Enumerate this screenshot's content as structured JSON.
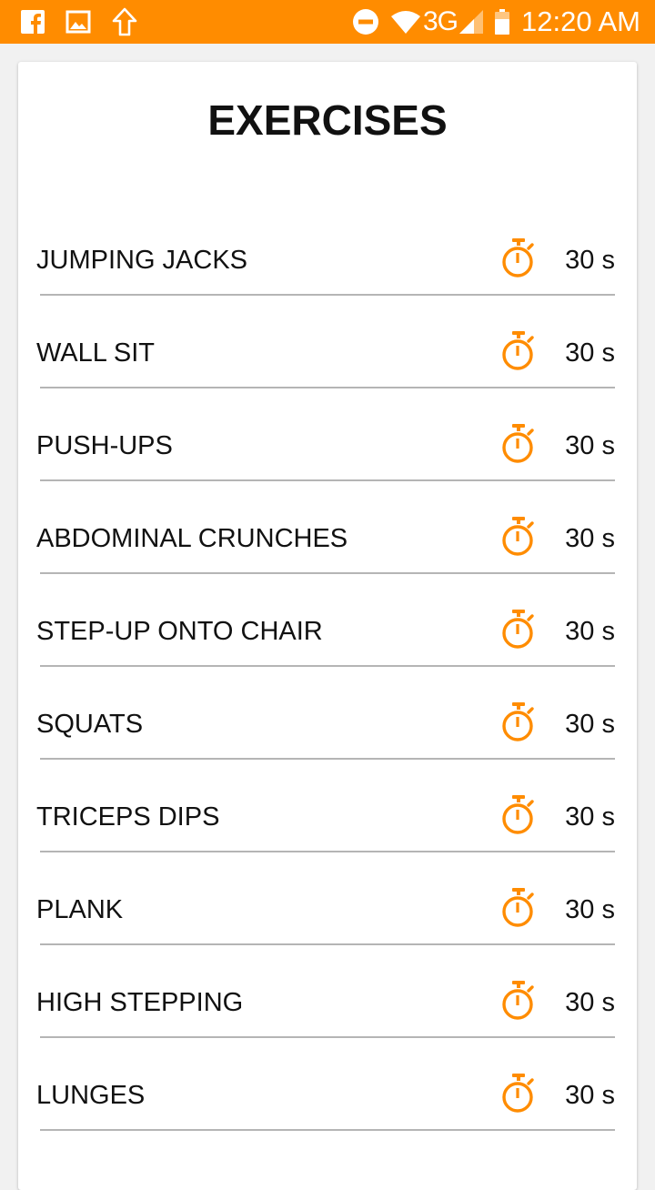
{
  "status_bar": {
    "left_icons": [
      "facebook-icon",
      "image-icon",
      "upload-arrow-icon"
    ],
    "right_icons": [
      "do-not-disturb-icon",
      "wifi-icon",
      "signal-icon",
      "battery-icon"
    ],
    "network": "3G",
    "time": "12:20 AM",
    "color": "#ff8c00"
  },
  "title": "EXERCISES",
  "accent_color": "#ff8c00",
  "exercises": [
    {
      "name": "JUMPING JACKS",
      "duration": "30 s"
    },
    {
      "name": "WALL SIT",
      "duration": "30 s"
    },
    {
      "name": "PUSH-UPS",
      "duration": "30 s"
    },
    {
      "name": "ABDOMINAL CRUNCHES",
      "duration": "30 s"
    },
    {
      "name": "STEP-UP ONTO CHAIR",
      "duration": "30 s"
    },
    {
      "name": "SQUATS",
      "duration": "30 s"
    },
    {
      "name": "TRICEPS DIPS",
      "duration": "30 s"
    },
    {
      "name": "PLANK",
      "duration": "30 s"
    },
    {
      "name": "HIGH STEPPING",
      "duration": "30 s"
    },
    {
      "name": "LUNGES",
      "duration": "30 s"
    }
  ]
}
